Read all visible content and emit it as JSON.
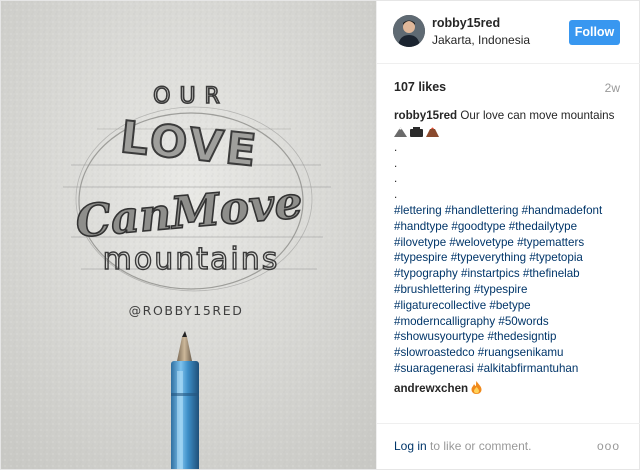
{
  "post": {
    "username": "robby15red",
    "location": "Jakarta, Indonesia",
    "follow_label": "Follow",
    "likes": "107 likes",
    "age": "2w"
  },
  "image": {
    "lettering_our": "OUR",
    "lettering_love": "LOVE",
    "lettering_can_move": "CanMove",
    "lettering_mountains": "mountains",
    "handle": "@ROBBY15RED"
  },
  "caption": {
    "user": "robby15red",
    "text": "Our love can move mountains",
    "dots": [
      ".",
      ".",
      ".",
      "."
    ],
    "hashtags": [
      "#lettering #handlettering #handmadefont",
      "#handtype #goodtype #thedailytype",
      "#ilovetype #welovetype #typematters",
      "#typespire #typeverything #typetopia",
      "#typography #instartpics #thefinelab",
      "#brushlettering #typespire",
      "#ligaturecollective #betype",
      "#moderncalligraphy #50words",
      "#showusyourtype #thedesigntip",
      "#slowroastedco #ruangsenikamu",
      "#suaragenerasi #alkitabfirmantuhan"
    ]
  },
  "comment": {
    "user": "andrewxchen"
  },
  "footer": {
    "login_link": "Log in",
    "login_rest": " to like or comment.",
    "more": "ooo"
  }
}
